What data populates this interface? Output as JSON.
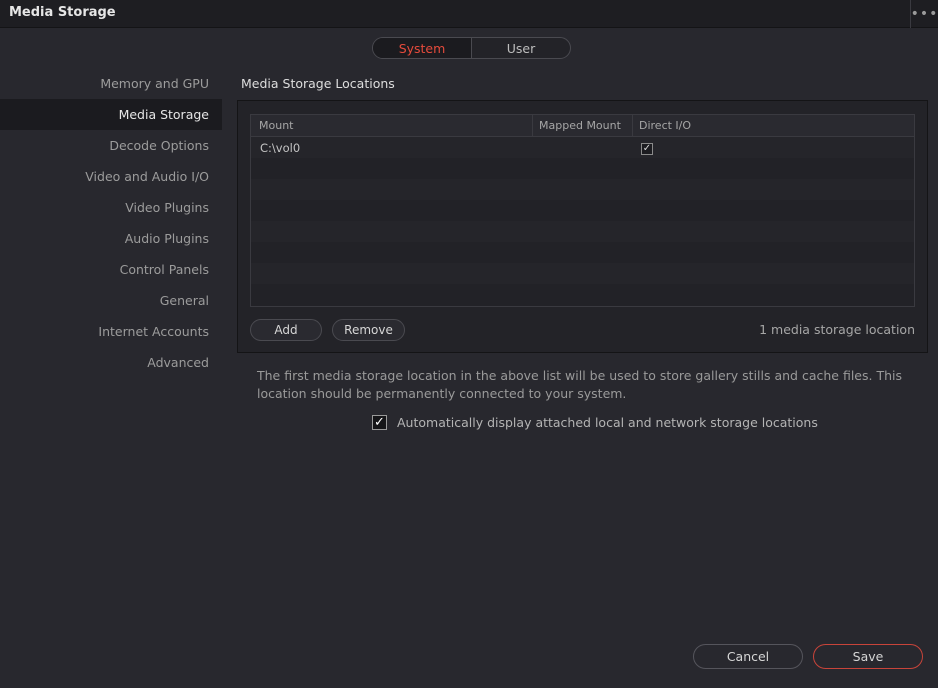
{
  "window": {
    "title": "Media Storage",
    "menu_label": "•••"
  },
  "scope_tabs": [
    {
      "label": "System",
      "active": true
    },
    {
      "label": "User",
      "active": false
    }
  ],
  "sidebar": {
    "items": [
      {
        "label": "Memory and GPU"
      },
      {
        "label": "Media Storage",
        "active": true
      },
      {
        "label": "Decode Options"
      },
      {
        "label": "Video and Audio I/O"
      },
      {
        "label": "Video Plugins"
      },
      {
        "label": "Audio Plugins"
      },
      {
        "label": "Control Panels"
      },
      {
        "label": "General"
      },
      {
        "label": "Internet Accounts"
      },
      {
        "label": "Advanced"
      }
    ]
  },
  "section": {
    "title": "Media Storage Locations",
    "table": {
      "columns": [
        "Mount",
        "Mapped Mount",
        "Direct I/O"
      ],
      "rows": [
        {
          "mount": "C:\\vol0",
          "mapped_mount": "",
          "direct_io": true
        }
      ]
    },
    "add_label": "Add",
    "remove_label": "Remove",
    "count_text": "1 media storage location"
  },
  "description": "The first media storage location in the above list will be used to store gallery stills and cache files. This location should be permanently connected to your system.",
  "auto_display": {
    "checked": true,
    "label": "Automatically display attached local and network storage locations"
  },
  "footer": {
    "cancel_label": "Cancel",
    "save_label": "Save"
  },
  "colors": {
    "accent": "#e64b3c",
    "background": "#28282e"
  }
}
